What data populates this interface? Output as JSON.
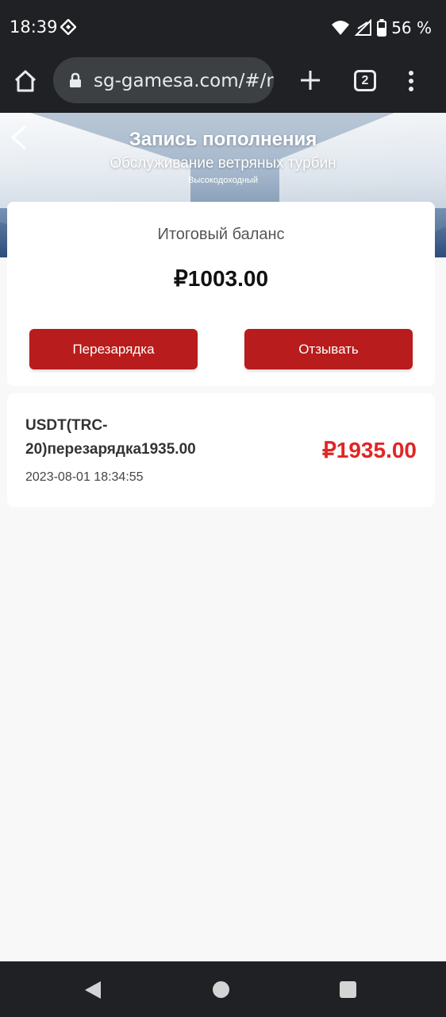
{
  "status_bar": {
    "time": "18:39",
    "battery": "56 %",
    "icons": [
      "binance-icon",
      "wifi-icon",
      "signal-icon",
      "battery-icon"
    ]
  },
  "browser": {
    "url": "sg-gamesa.com/#/re",
    "tab_count": "2"
  },
  "header": {
    "title": "Запись пополнения",
    "subtitle": "Обслуживание ветряных турбин",
    "tagline": "Высокодоходный"
  },
  "balance": {
    "label": "Итоговый баланс",
    "value": "₽1003.00",
    "recharge_label": "Перезарядка",
    "withdraw_label": "Отзывать"
  },
  "records": [
    {
      "title": "USDT(TRC-20)перезарядка1935.00",
      "date": "2023-08-01 18:34:55",
      "amount": "₽1935.00"
    }
  ],
  "colors": {
    "accent": "#b81c1c",
    "amount": "#e02626",
    "system_bar": "#202124"
  }
}
